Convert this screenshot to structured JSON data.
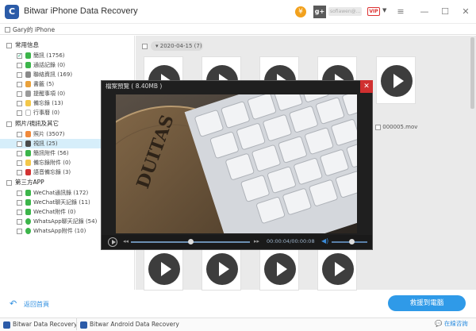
{
  "app": {
    "title": "Bitwar iPhone Data Recovery",
    "logo": "C"
  },
  "titlebar": {
    "gplus": "g+",
    "email": "sofiawen@...",
    "vip": "VIP",
    "menu_icon": "≡",
    "minimize": "—",
    "maximize": "☐",
    "close": "✕"
  },
  "device": {
    "name": "Gary的 iPhone"
  },
  "sidebar": {
    "groups": [
      {
        "label": "常用信息",
        "items": [
          {
            "label": "簡訊 (1756)",
            "checked": true,
            "color": "#3cb54a"
          },
          {
            "label": "通話記錄 (0)",
            "color": "#3cb54a"
          },
          {
            "label": "聯絡資訊 (169)",
            "color": "#8a8a8a"
          },
          {
            "label": "書籤 (5)",
            "color": "#e9a13b"
          },
          {
            "label": "提醒事項 (0)",
            "color": "#9a9a9a"
          },
          {
            "label": "備忘錄 (13)",
            "color": "#f3c74a"
          },
          {
            "label": "行事曆 (0)",
            "color": "#ffffff"
          }
        ]
      },
      {
        "label": "照片/視訊及其它",
        "items": [
          {
            "label": "照片 (3507)",
            "color": "#f08a3c"
          },
          {
            "label": "視訊 (25)",
            "color": "#4a4a4a",
            "selected": true
          },
          {
            "label": "簡訊附件 (56)",
            "color": "#3cb54a"
          },
          {
            "label": "備忘錄附件 (0)",
            "color": "#f3c74a"
          },
          {
            "label": "語音備忘錄 (3)",
            "color": "#d23434"
          }
        ]
      },
      {
        "label": "第三方APP",
        "items": [
          {
            "label": "WeChat通訊錄 (172)",
            "color": "#3cb54a"
          },
          {
            "label": "WeChat聊天記錄 (11)",
            "color": "#3cb54a"
          },
          {
            "label": "WeChat附件 (0)",
            "color": "#3cb54a"
          },
          {
            "label": "WhatsApp聊天記錄 (54)",
            "color": "#3cb54a"
          },
          {
            "label": "WhatsApp附件 (10)",
            "color": "#3cb54a"
          }
        ]
      }
    ]
  },
  "content": {
    "date_group": "2020-04-15 (7)",
    "file_label": "000005.mov"
  },
  "preview": {
    "title": "檔案預覽 ( 8.40MB )",
    "close": "✕",
    "rewind": "◂◂",
    "forward": "▸▸",
    "time": "00:00:04/00:00:08",
    "volume_icon": "◀)",
    "progress": 0.5,
    "volume": 0.55
  },
  "bottom": {
    "back_label": "返回首頁",
    "recover_label": "救援到電腦"
  },
  "footer": {
    "tab1": "Bitwar Data Recovery",
    "tab2": "Bitwar Android Data Recovery",
    "consult": "在線咨詢"
  }
}
